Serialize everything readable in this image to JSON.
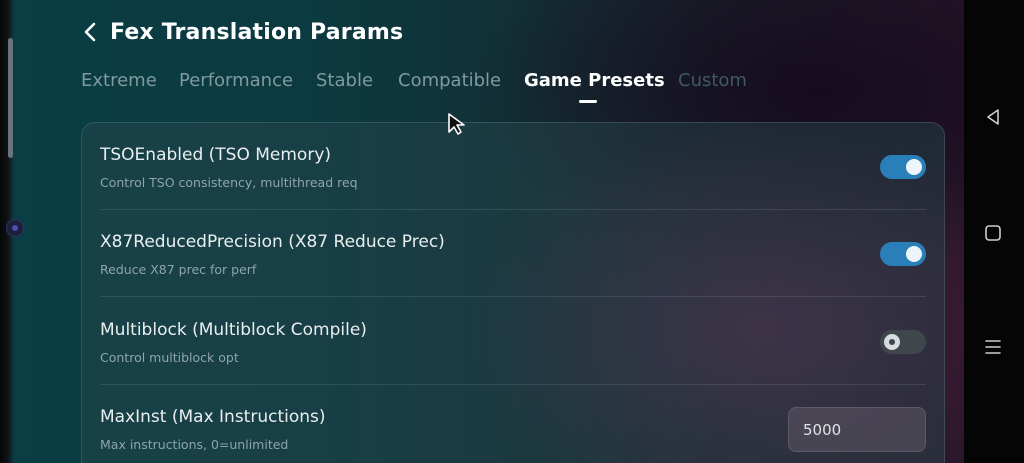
{
  "header": {
    "title": "Fex Translation Params"
  },
  "tabs": [
    {
      "label": "Extreme"
    },
    {
      "label": "Performance"
    },
    {
      "label": "Stable"
    },
    {
      "label": "Compatible"
    },
    {
      "label": "Game Presets"
    },
    {
      "label": "Custom"
    }
  ],
  "active_tab": "Game Presets",
  "settings": [
    {
      "title": "TSOEnabled (TSO Memory)",
      "desc": "Control TSO consistency, multithread req",
      "enabled": true
    },
    {
      "title": "X87ReducedPrecision (X87 Reduce Prec)",
      "desc": "Reduce X87 prec for perf",
      "enabled": true
    },
    {
      "title": "Multiblock (Multiblock Compile)",
      "desc": "Control multiblock opt",
      "enabled": false
    },
    {
      "title": "MaxInst (Max Instructions)",
      "desc": "Max instructions, 0=unlimited",
      "value": "5000"
    }
  ],
  "colors": {
    "toggle_on": "#2a7fb8",
    "toggle_off": "#3f474c",
    "accent_text": "#ffffff"
  },
  "icons": {
    "back": "chevron-left-icon",
    "nav_back": "triangle-back-icon",
    "nav_home": "square-home-icon",
    "nav_menu": "menu-lines-icon"
  }
}
